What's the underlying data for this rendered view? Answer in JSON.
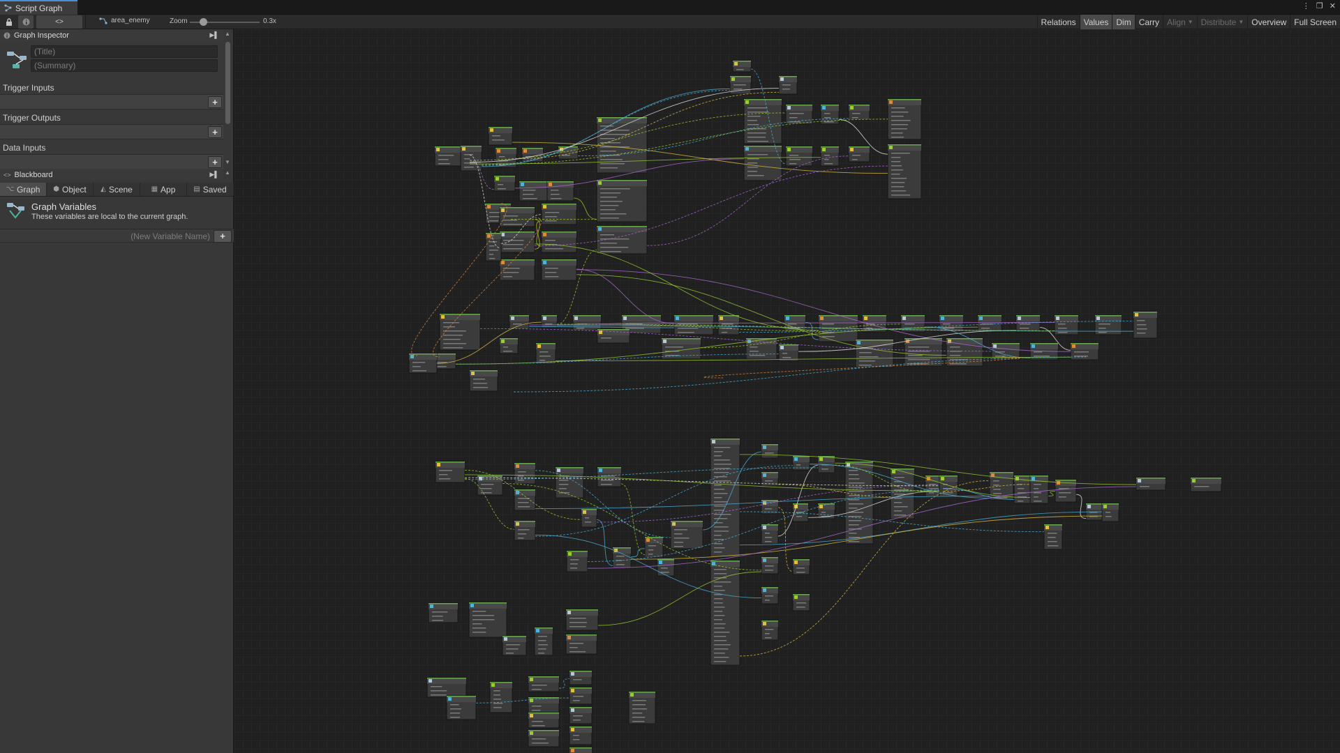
{
  "window": {
    "tab_title": "Script Graph",
    "controls": [
      "⋮",
      "❐",
      "✕"
    ]
  },
  "toolbar": {
    "breadcrumb": "area_enemy",
    "zoom_label": "Zoom",
    "zoom_value": "0.3x",
    "zoom_level": 0.3,
    "right_tools": [
      {
        "label": "Relations",
        "active": false,
        "disabled": false,
        "dropdown": false
      },
      {
        "label": "Values",
        "active": true,
        "disabled": false,
        "dropdown": false
      },
      {
        "label": "Dim",
        "active": true,
        "disabled": false,
        "dropdown": false
      },
      {
        "label": "Carry",
        "active": false,
        "disabled": false,
        "dropdown": false
      },
      {
        "label": "Align",
        "active": false,
        "disabled": true,
        "dropdown": true
      },
      {
        "label": "Distribute",
        "active": false,
        "disabled": true,
        "dropdown": true
      },
      {
        "label": "Overview",
        "active": false,
        "disabled": false,
        "dropdown": false
      },
      {
        "label": "Full Screen",
        "active": false,
        "disabled": false,
        "dropdown": false
      }
    ]
  },
  "inspector": {
    "header": "Graph Inspector",
    "title_placeholder": "(Title)",
    "summary_placeholder": "(Summary)",
    "sections": [
      "Trigger Inputs",
      "Trigger Outputs",
      "Data Inputs"
    ]
  },
  "blackboard": {
    "header": "Blackboard",
    "tabs": [
      "Graph",
      "Object",
      "Scene",
      "App",
      "Saved"
    ],
    "active_tab": "Graph",
    "variables_title": "Graph Variables",
    "variables_desc": "These variables are local to the current graph.",
    "new_variable_placeholder": "(New Variable Name)"
  },
  "colors": {
    "flow_edge": "#e6e6e6",
    "float_edge": "#9acd32",
    "object_edge": "#4fb3d9",
    "vector_edge": "#e0c040",
    "event_edge": "#e08a3c",
    "bool_edge": "#b06ad6"
  }
}
